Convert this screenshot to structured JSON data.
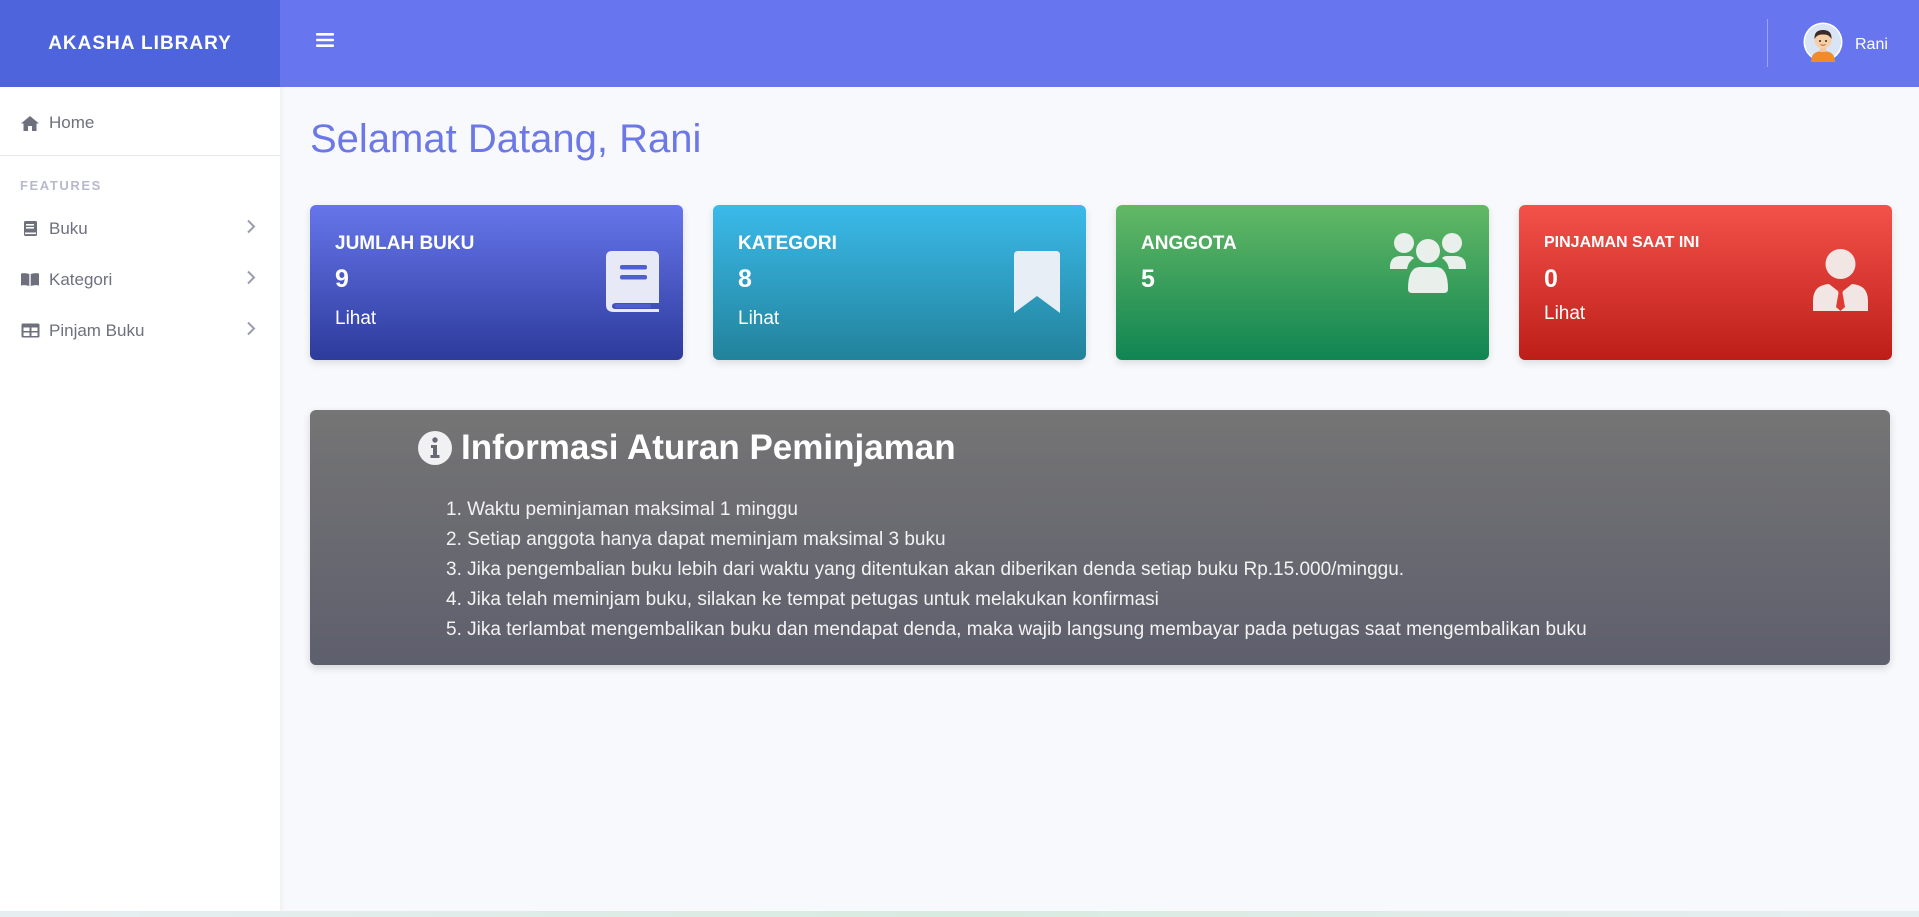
{
  "brand": {
    "title": "AKASHA LIBRARY"
  },
  "sidebar": {
    "home": {
      "label": "Home",
      "icon": "home-icon"
    },
    "heading": "FEATURES",
    "items": [
      {
        "label": "Buku",
        "icon": "book-icon"
      },
      {
        "label": "Kategori",
        "icon": "book-open-icon"
      },
      {
        "label": "Pinjam Buku",
        "icon": "table-icon"
      }
    ]
  },
  "topbar": {
    "user_name": "Rani"
  },
  "main": {
    "title": "Selamat Datang, Rani",
    "cards": [
      {
        "label": "JUMLAH BUKU",
        "count": "9",
        "link": "Lihat",
        "icon": "book-icon",
        "color": "#4e5fd0"
      },
      {
        "label": "KATEGORI",
        "count": "8",
        "link": "Lihat",
        "icon": "bookmark-icon",
        "color": "#2fa3c8"
      },
      {
        "label": "ANGGOTA",
        "count": "5",
        "icon": "users-icon",
        "color": "#3ba25b"
      },
      {
        "label": "PINJAMAN SAAT INI",
        "count": "0",
        "link": "Lihat",
        "icon": "user-tie-icon",
        "color": "#e03a33"
      }
    ],
    "info": {
      "title": "Informasi Aturan Peminjaman",
      "rules": [
        "1. Waktu peminjaman maksimal 1 minggu",
        "2. Setiap anggota hanya dapat meminjam maksimal 3 buku",
        "3. Jika pengembalian buku lebih dari waktu yang ditentukan akan diberikan denda setiap buku Rp.15.000/minggu.",
        "4. Jika telah meminjam buku, silakan ke tempat petugas untuk melakukan konfirmasi",
        "5. Jika terlambat mengembalikan buku dan mendapat denda, maka wajib langsung membayar pada petugas saat mengembalikan buku"
      ]
    }
  }
}
